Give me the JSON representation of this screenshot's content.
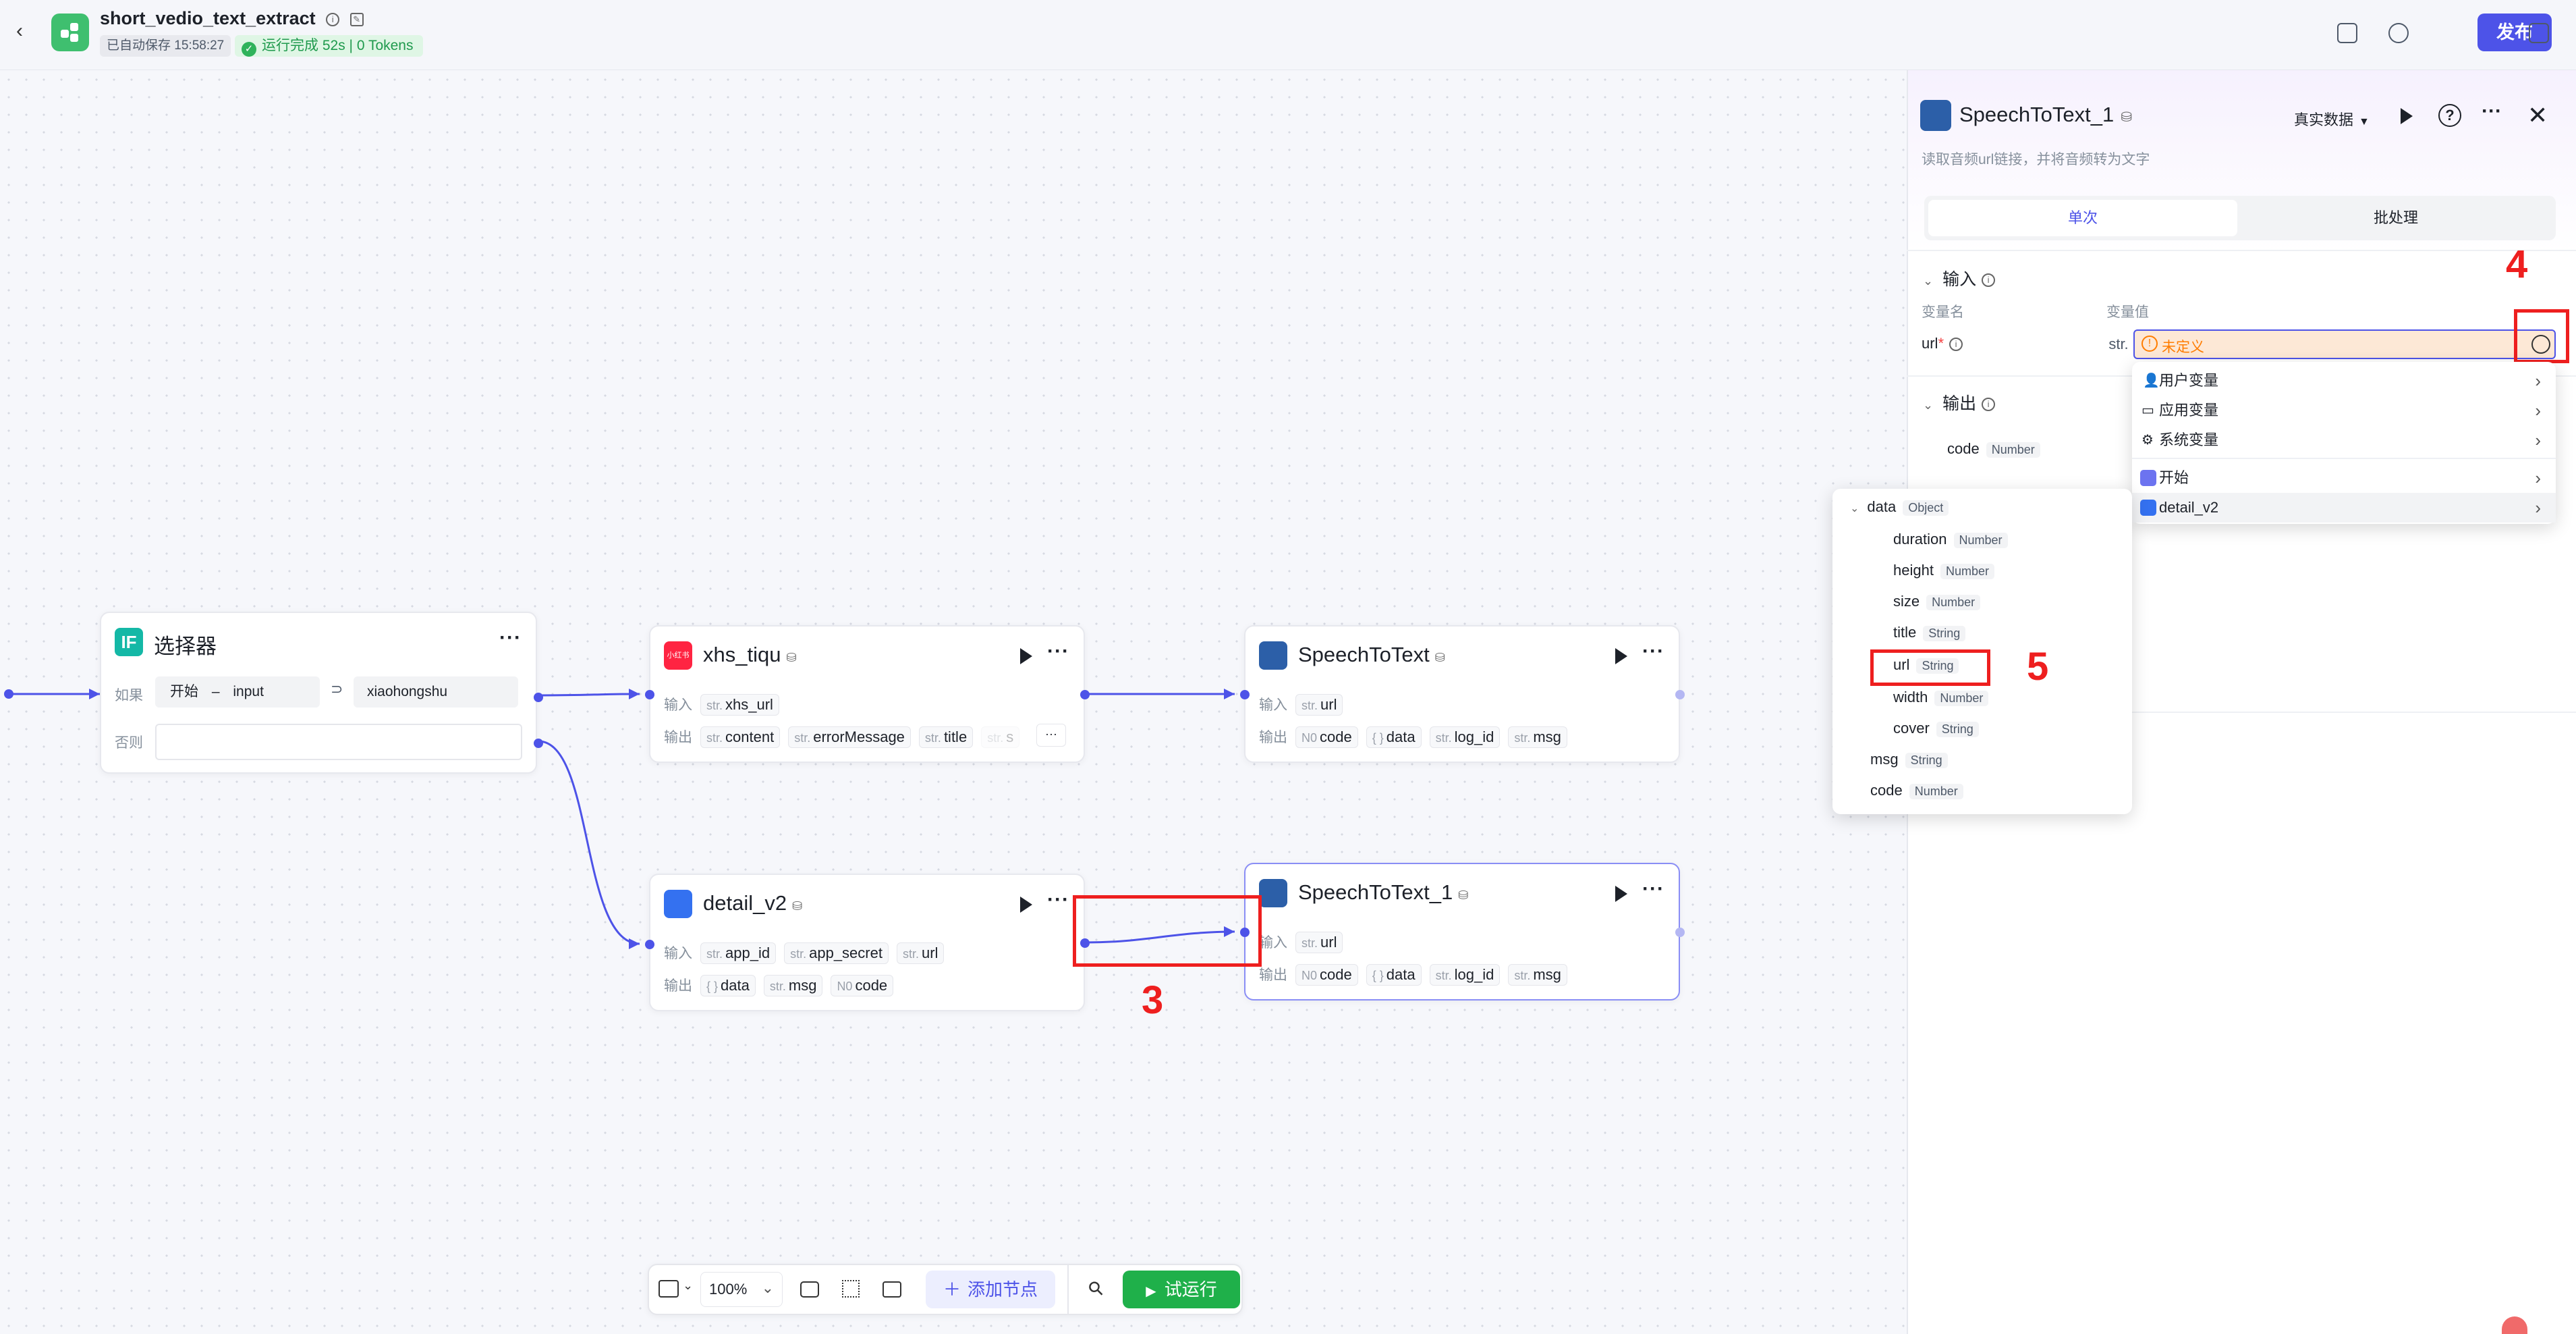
{
  "header": {
    "app_name": "short_vedio_text_extract",
    "autosave": "已自动保存 15:58:27",
    "run_status": "运行完成 52s | 0 Tokens",
    "publish": "发布"
  },
  "nodes": {
    "selector": {
      "title": "选择器",
      "if_label": "如果",
      "cond_left_src": "开始",
      "cond_left_sep": "–",
      "cond_left_var": "input",
      "cond_op": "⊃",
      "cond_right": "xiaohongshu",
      "else_label": "否则"
    },
    "xhs": {
      "icon_text": "小红书",
      "title": "xhs_tiqu",
      "in_label": "输入",
      "inputs": [
        {
          "t": "str.",
          "v": "xhs_url"
        }
      ],
      "out_label": "输出",
      "outputs": [
        {
          "t": "str.",
          "v": "content"
        },
        {
          "t": "str.",
          "v": "errorMessage"
        },
        {
          "t": "str.",
          "v": "title"
        },
        {
          "t": "str.",
          "v": "s"
        }
      ]
    },
    "stt": {
      "title": "SpeechToText",
      "in_label": "输入",
      "inputs": [
        {
          "t": "str.",
          "v": "url"
        }
      ],
      "out_label": "输出",
      "outputs": [
        {
          "t": "N0",
          "v": "code"
        },
        {
          "t": "{ }",
          "v": "data"
        },
        {
          "t": "str.",
          "v": "log_id"
        },
        {
          "t": "str.",
          "v": "msg"
        }
      ]
    },
    "detail": {
      "title": "detail_v2",
      "in_label": "输入",
      "inputs": [
        {
          "t": "str.",
          "v": "app_id"
        },
        {
          "t": "str.",
          "v": "app_secret"
        },
        {
          "t": "str.",
          "v": "url"
        }
      ],
      "out_label": "输出",
      "outputs": [
        {
          "t": "{ }",
          "v": "data"
        },
        {
          "t": "str.",
          "v": "msg"
        },
        {
          "t": "N0",
          "v": "code"
        }
      ]
    },
    "stt1": {
      "title": "SpeechToText_1",
      "in_label": "输入",
      "inputs": [
        {
          "t": "str.",
          "v": "url"
        }
      ],
      "out_label": "输出",
      "outputs": [
        {
          "t": "N0",
          "v": "code"
        },
        {
          "t": "{ }",
          "v": "data"
        },
        {
          "t": "str.",
          "v": "log_id"
        },
        {
          "t": "str.",
          "v": "msg"
        }
      ]
    }
  },
  "annotations": {
    "n3": "3",
    "n4": "4",
    "n5": "5"
  },
  "toolbar": {
    "zoom": "100%",
    "add_node": "添加节点",
    "trial_run": "试运行"
  },
  "panel": {
    "title": "SpeechToText_1",
    "data_mode": "真实数据",
    "description": "读取音频url链接，并将音频转为文字",
    "tab_single": "单次",
    "tab_batch": "批处理",
    "input_section": "输入",
    "col_name": "变量名",
    "col_value": "变量值",
    "url_name": "url",
    "url_required": "*",
    "url_type": "str.",
    "url_value": "未定义",
    "output_section": "输出",
    "output_code": "code",
    "output_code_type": "Number"
  },
  "var_menu": {
    "items": [
      "用户变量",
      "应用变量",
      "系统变量"
    ],
    "nodes": [
      "开始",
      "detail_v2"
    ]
  },
  "var_tree": {
    "root": {
      "name": "data",
      "type": "Object"
    },
    "children": [
      {
        "name": "duration",
        "type": "Number"
      },
      {
        "name": "height",
        "type": "Number"
      },
      {
        "name": "size",
        "type": "Number"
      },
      {
        "name": "title",
        "type": "String"
      },
      {
        "name": "url",
        "type": "String"
      },
      {
        "name": "width",
        "type": "Number"
      },
      {
        "name": "cover",
        "type": "String"
      }
    ],
    "siblings": [
      {
        "name": "msg",
        "type": "String"
      },
      {
        "name": "code",
        "type": "Number"
      }
    ]
  },
  "colors": {
    "accent": "#4d53e8",
    "success": "#1fb04a",
    "annotation": "#ee1f1f",
    "warning": "#ff7d00"
  }
}
